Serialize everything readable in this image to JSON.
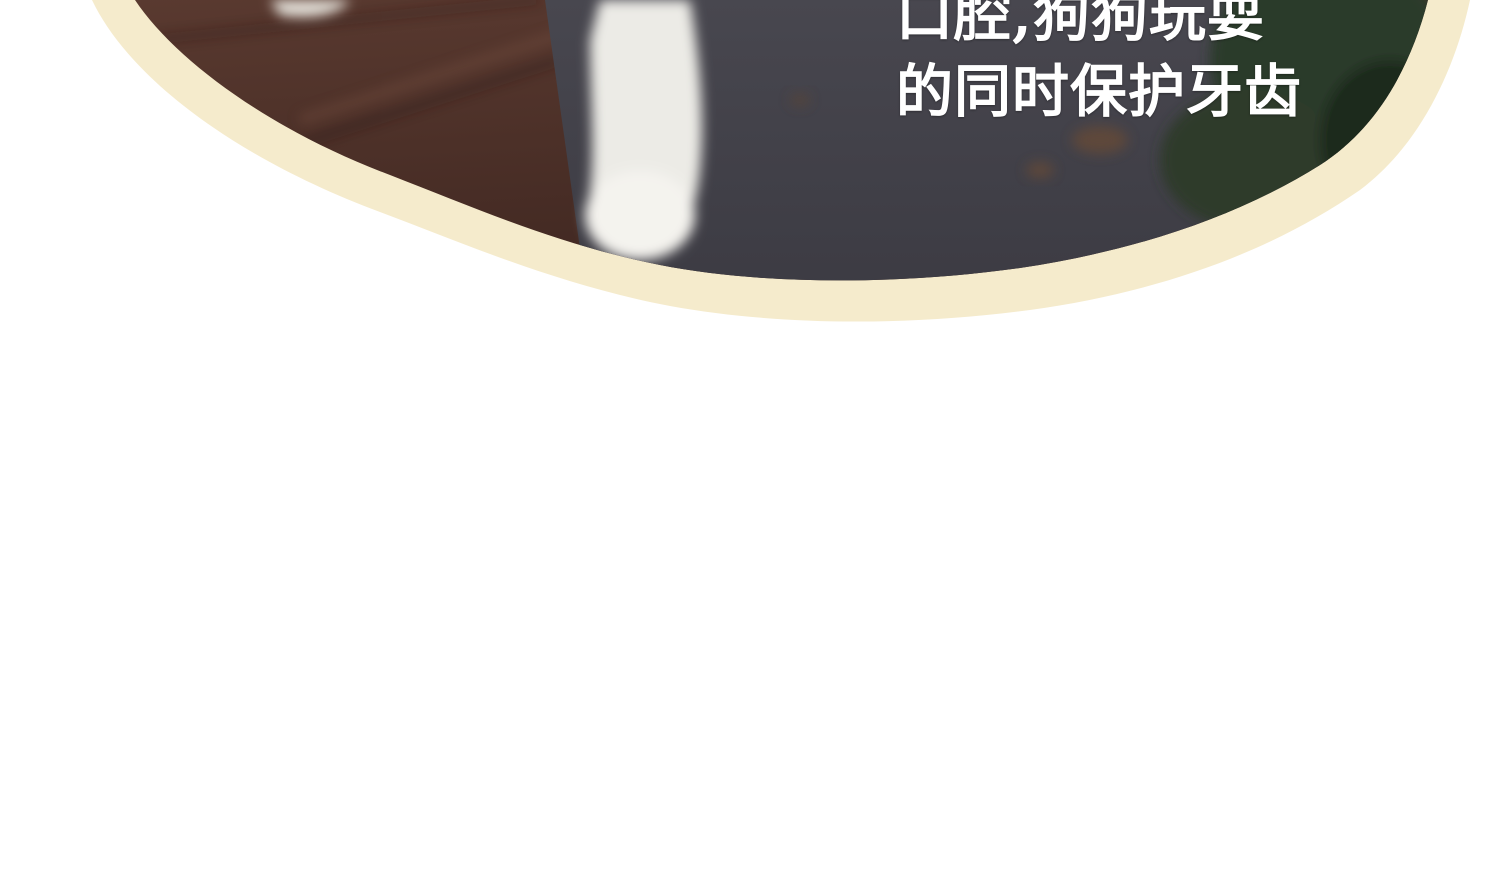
{
  "caption": {
    "line1": "口腔,狗狗玩耍",
    "line2": "的同时保护牙齿"
  },
  "colors": {
    "frame": "#f5ebcc",
    "background": "#ffffff",
    "text": "#ffffff"
  }
}
